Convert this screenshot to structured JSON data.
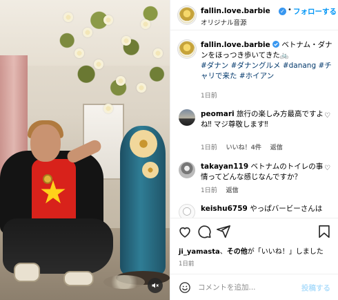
{
  "post": {
    "username": "fallin.love.barbie",
    "follow_label": "フォローする",
    "subtitle": "オリジナル音源",
    "caption": {
      "username": "fallin.love.barbie",
      "text": "ベトナム・ダナンをほっつき歩いてきた",
      "hashtags": [
        "#ダナン",
        "#ダナングルメ",
        "#danang",
        "#チャリで来た",
        "#ホイアン"
      ],
      "time": "1日前"
    }
  },
  "comments": [
    {
      "username": "peomari",
      "text": "旅行の楽しみ方最高ですよね‼︎ マジ尊敬します‼︎",
      "time": "1日前",
      "likes": "いいね！4件",
      "reply": "返信"
    },
    {
      "username": "takayan119",
      "text": "ベトナムのトイレの事情ってどんな感じなんですか？",
      "time": "1日前",
      "reply": "返信"
    },
    {
      "username": "keishu6759",
      "text": "やっぱバービーさんは"
    }
  ],
  "likes_line": {
    "user": "ji_yamasta",
    "connector": "、",
    "others": "その他",
    "suffix": "が「いいね！」しました"
  },
  "post_date": "1日前",
  "composer": {
    "placeholder": "コメントを追加...",
    "post_label": "投稿する"
  },
  "icons": [
    "verified-badge",
    "heart-icon",
    "comment-icon",
    "share-icon",
    "bookmark-icon",
    "emoji-icon",
    "mute-icon",
    "more-icon"
  ],
  "colors": {
    "accent": "#0095f6",
    "verified": "#3897f0",
    "hashtag": "#00376b",
    "muted": "#737373",
    "post_disabled": "#b2dffc"
  }
}
